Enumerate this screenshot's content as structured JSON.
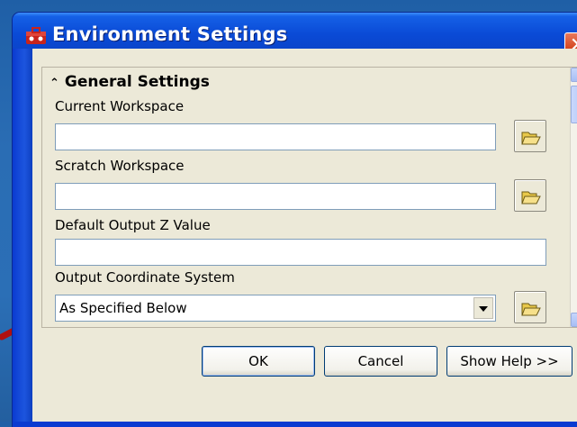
{
  "window": {
    "title": "Environment Settings",
    "close_symbol": "✕"
  },
  "section": {
    "header": "General Settings",
    "chevron": "⌃"
  },
  "fields": {
    "current_workspace": {
      "label": "Current Workspace",
      "value": ""
    },
    "scratch_workspace": {
      "label": "Scratch Workspace",
      "value": ""
    },
    "default_output_z": {
      "label": "Default Output Z Value",
      "value": ""
    },
    "output_coordinate_system": {
      "label": "Output Coordinate System",
      "value": "As Specified Below"
    }
  },
  "buttons": {
    "ok": "OK",
    "cancel": "Cancel",
    "show_help": "Show Help >>"
  },
  "colors": {
    "titlebar": "#0a4ad6",
    "close": "#d4461f",
    "annotation_arrow": "#b01010",
    "dialog_bg": "#ece9d8"
  },
  "icons": {
    "title": "toolbox-icon",
    "browse": "folder-open-icon",
    "coordinate": "coordinate-system-icon"
  }
}
